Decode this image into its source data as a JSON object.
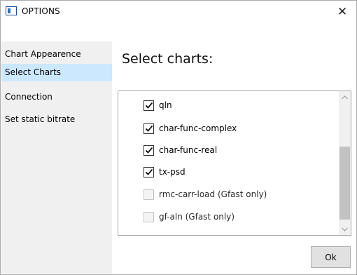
{
  "window": {
    "title": "OPTIONS",
    "close_glyph": "✕"
  },
  "sidebar": {
    "items": [
      {
        "label": "Chart Appearence",
        "selected": false
      },
      {
        "label": "Select Charts",
        "selected": true
      },
      {
        "label": "Connection",
        "selected": false
      },
      {
        "label": "Set static bitrate",
        "selected": false
      }
    ]
  },
  "main": {
    "title": "Select charts:",
    "charts": [
      {
        "label": "qln",
        "checked": true,
        "enabled": true
      },
      {
        "label": "char-func-complex",
        "checked": true,
        "enabled": true
      },
      {
        "label": "char-func-real",
        "checked": true,
        "enabled": true
      },
      {
        "label": "tx-psd",
        "checked": true,
        "enabled": true
      },
      {
        "label": "rmc-carr-load (Gfast only)",
        "checked": false,
        "enabled": false
      },
      {
        "label": "gf-aln (Gfast only)",
        "checked": false,
        "enabled": false
      }
    ]
  },
  "buttons": {
    "ok_label": "Ok"
  },
  "colors": {
    "selected_item_bg": "#cce8ff",
    "sidebar_bg": "#f0f0f0",
    "button_bg": "#e1e1e1"
  }
}
